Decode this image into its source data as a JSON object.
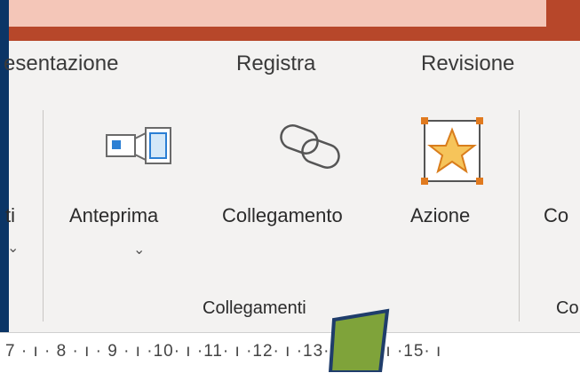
{
  "tabs": [
    "esentazione",
    "Registra",
    "Revisione"
  ],
  "ribbon": {
    "partial_left_label": "ti",
    "buttons": [
      {
        "label": "Anteprima",
        "icon": "preview-icon"
      },
      {
        "label": "Collegamento",
        "icon": "link-icon"
      },
      {
        "label": "Azione",
        "icon": "action-star-icon"
      },
      {
        "label": "Co",
        "icon": ""
      }
    ],
    "group_labels": [
      "Collegamenti",
      "Co"
    ]
  },
  "ruler": {
    "text": "7 · ı · 8 · ı · 9 · ı ·10· ı ·11· ı ·12· ı ·13· ı ·14· ı ·15· ı"
  },
  "colors": {
    "title_bar": "#b7472a",
    "frame": "#0b3566",
    "ribbon_bg": "#f3f2f1",
    "arrow": "#7fa33a",
    "accent_orange": "#e07a1f"
  }
}
